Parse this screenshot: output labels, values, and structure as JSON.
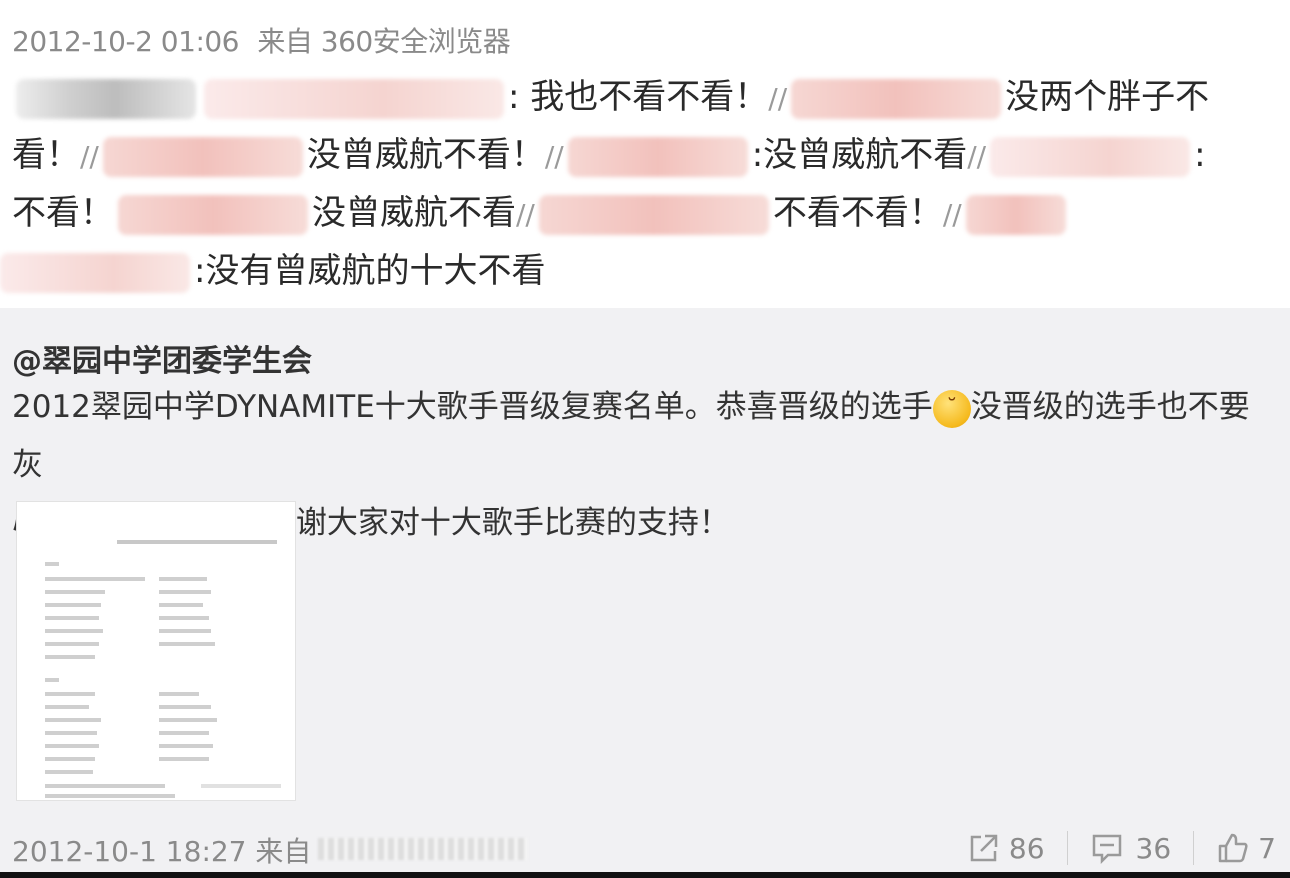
{
  "repost": {
    "meta_time": "2012-10-2 01:06",
    "meta_source": "来自 360安全浏览器",
    "line1": {
      "seg1": ": 我也不看不看！",
      "seg2": "//",
      "seg3": "没两个胖子不"
    },
    "line2": {
      "seg1": "看！",
      "seg2": "//",
      "seg3": "没曾威航不看！",
      "seg4": "//",
      "seg5": ":没曾威航不看",
      "seg6": "//",
      "seg7": ":"
    },
    "line3": {
      "seg1": "不看！",
      "seg2": "没曾威航不看",
      "seg3": "//",
      "seg4": "不看不看！",
      "seg5": "//"
    },
    "line4": {
      "seg1": ":没有曾威航的十大不看"
    }
  },
  "original": {
    "author": "@翠园中学团委学生会",
    "text_part1": "2012翠园中学DYNAMITE十大歌手晋级复赛名单。恭喜晋级的选手",
    "text_part2": "没晋级的选手也不要灰",
    "text_line2": "心 重在参与~再次感谢大家对十大歌手比赛的支持！",
    "footer_time": "2012-10-1 18:27",
    "footer_source": "来自",
    "actions": {
      "repost_count": "86",
      "comment_count": "36",
      "like_count": "7"
    }
  },
  "colors": {
    "meta_gray": "#8a8a8a",
    "original_bg": "#f1f1f3"
  }
}
